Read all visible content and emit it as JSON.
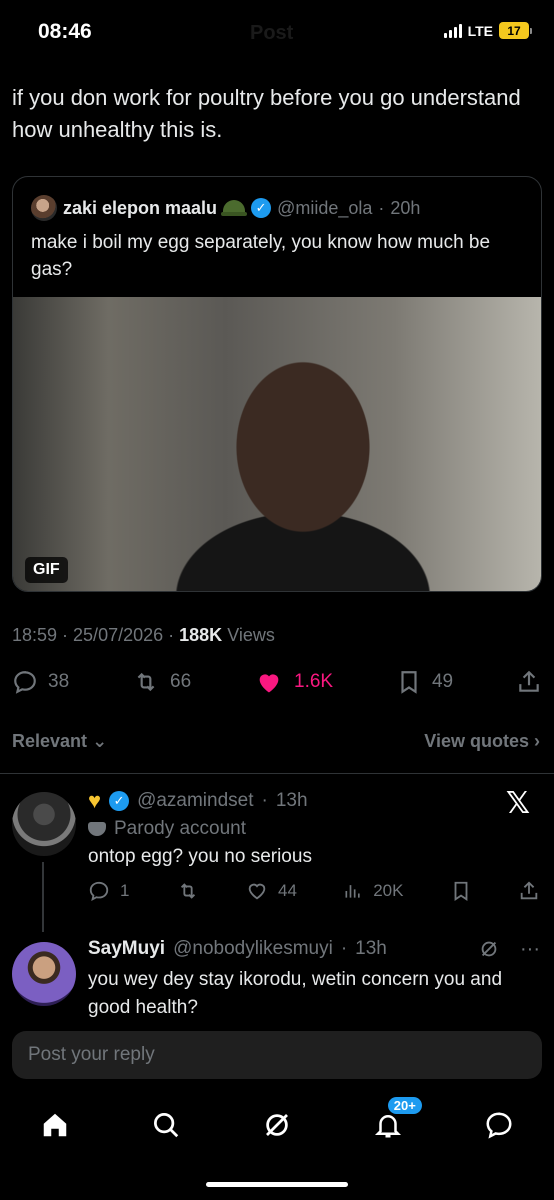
{
  "status_bar": {
    "time": "08:46",
    "ghost_title": "Post",
    "network": "LTE",
    "battery": "17"
  },
  "post": {
    "text": "if you don work for poultry before you go understand how unhealthy this is.",
    "quote": {
      "name": "zaki elepon maalu",
      "handle": "@miide_ola",
      "time": "20h",
      "text": "make i boil my egg separately, you know how much be gas?",
      "media_badge": "GIF"
    },
    "timestamp": "18:59 · 25/07/2026 ·",
    "views_count": "188K",
    "views_label": "Views",
    "actions": {
      "replies": "38",
      "reposts": "66",
      "likes": "1.6K",
      "bookmarks": "49"
    },
    "like_color": "#f91880"
  },
  "filters": {
    "sort": "Relevant",
    "view_quotes": "View quotes"
  },
  "replies": [
    {
      "handle": "@azamindset",
      "time": "13h",
      "label": "Parody account",
      "text": "ontop egg? you no serious",
      "actions": {
        "replies": "1",
        "likes": "44",
        "views": "20K"
      }
    },
    {
      "name": "SayMuyi",
      "handle": "@nobodylikesmuyi",
      "time": "13h",
      "text": "you wey dey stay ikorodu, wetin concern you and good health?"
    }
  ],
  "compose": {
    "placeholder": "Post your reply"
  },
  "nav": {
    "notifications_badge": "20+"
  },
  "colors": {
    "accent": "#1d9bf0",
    "background": "#000000",
    "muted": "#71767b"
  },
  "icons": [
    "home-icon",
    "search-icon",
    "grok-icon",
    "bell-icon",
    "messages-icon",
    "reply-icon",
    "repost-icon",
    "heart-icon",
    "bookmark-icon",
    "share-icon",
    "views-icon",
    "x-logo-icon",
    "more-icon"
  ]
}
